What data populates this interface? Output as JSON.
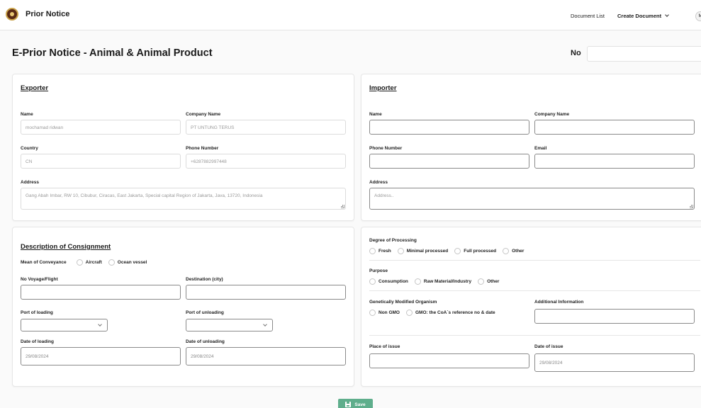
{
  "header": {
    "brand": "Prior Notice",
    "nav": {
      "document_list": "Document List",
      "create_document": "Create Document"
    },
    "avatar_initial": "M"
  },
  "page": {
    "title": "E-Prior Notice - Animal & Animal Product",
    "no_label": "No",
    "no_value": ""
  },
  "exporter": {
    "title": "Exporter",
    "name_label": "Name",
    "name_value": "mochamad ridwan",
    "company_label": "Company Name",
    "company_value": "PT UNTUNG TERUS",
    "country_label": "Country",
    "country_value": "CN",
    "phone_label": "Phone Number",
    "phone_value": "+6287882997448",
    "address_label": "Address",
    "address_value": "Gang Abah Imbar, RW 10, Cibubur, Ciracas, East Jakarta, Special capital Region of Jakarta, Java, 13720, Indonesia"
  },
  "importer": {
    "title": "Importer",
    "name_label": "Name",
    "company_label": "Company Name",
    "phone_label": "Phone Number",
    "email_label": "Email",
    "address_label": "Address",
    "address_placeholder": "Address.."
  },
  "consignment": {
    "title": "Description of Consignment",
    "conveyance_label": "Mean of Conveyance",
    "conveyance_options": [
      "Aircraft",
      "Ocean vessel"
    ],
    "voyage_label": "No Voyage/Flight",
    "destination_label": "Destination (city)",
    "port_loading_label": "Port of loading",
    "port_unloading_label": "Port of unloading",
    "date_loading_label": "Date of loading",
    "date_loading_value": "29/08/2024",
    "date_unloading_label": "Date of unloading",
    "date_unloading_value": "29/08/2024"
  },
  "processing": {
    "degree_label": "Degree of Processing",
    "degree_options": [
      "Fresh",
      "Minimal processed",
      "Full processed",
      "Other"
    ],
    "purpose_label": "Purpose",
    "purpose_options": [
      "Consumption",
      "Raw Material/Industry",
      "Other"
    ],
    "gmo_label": "Genetically Modified Organism",
    "gmo_options": [
      "Non GMO",
      "GMO: the CoA`s reference no & date"
    ],
    "additional_label": "Additional Information",
    "place_label": "Place of issue",
    "date_issue_label": "Date of issue",
    "date_issue_value": "29/08/2024"
  },
  "actions": {
    "save_label": "Save"
  },
  "colors": {
    "save_button": "#5fae8c",
    "brand_logo": "#5a2a14"
  },
  "icons": {
    "brand": "emblem-icon",
    "save": "floppy-icon",
    "dropdown": "chevron-down-icon"
  }
}
